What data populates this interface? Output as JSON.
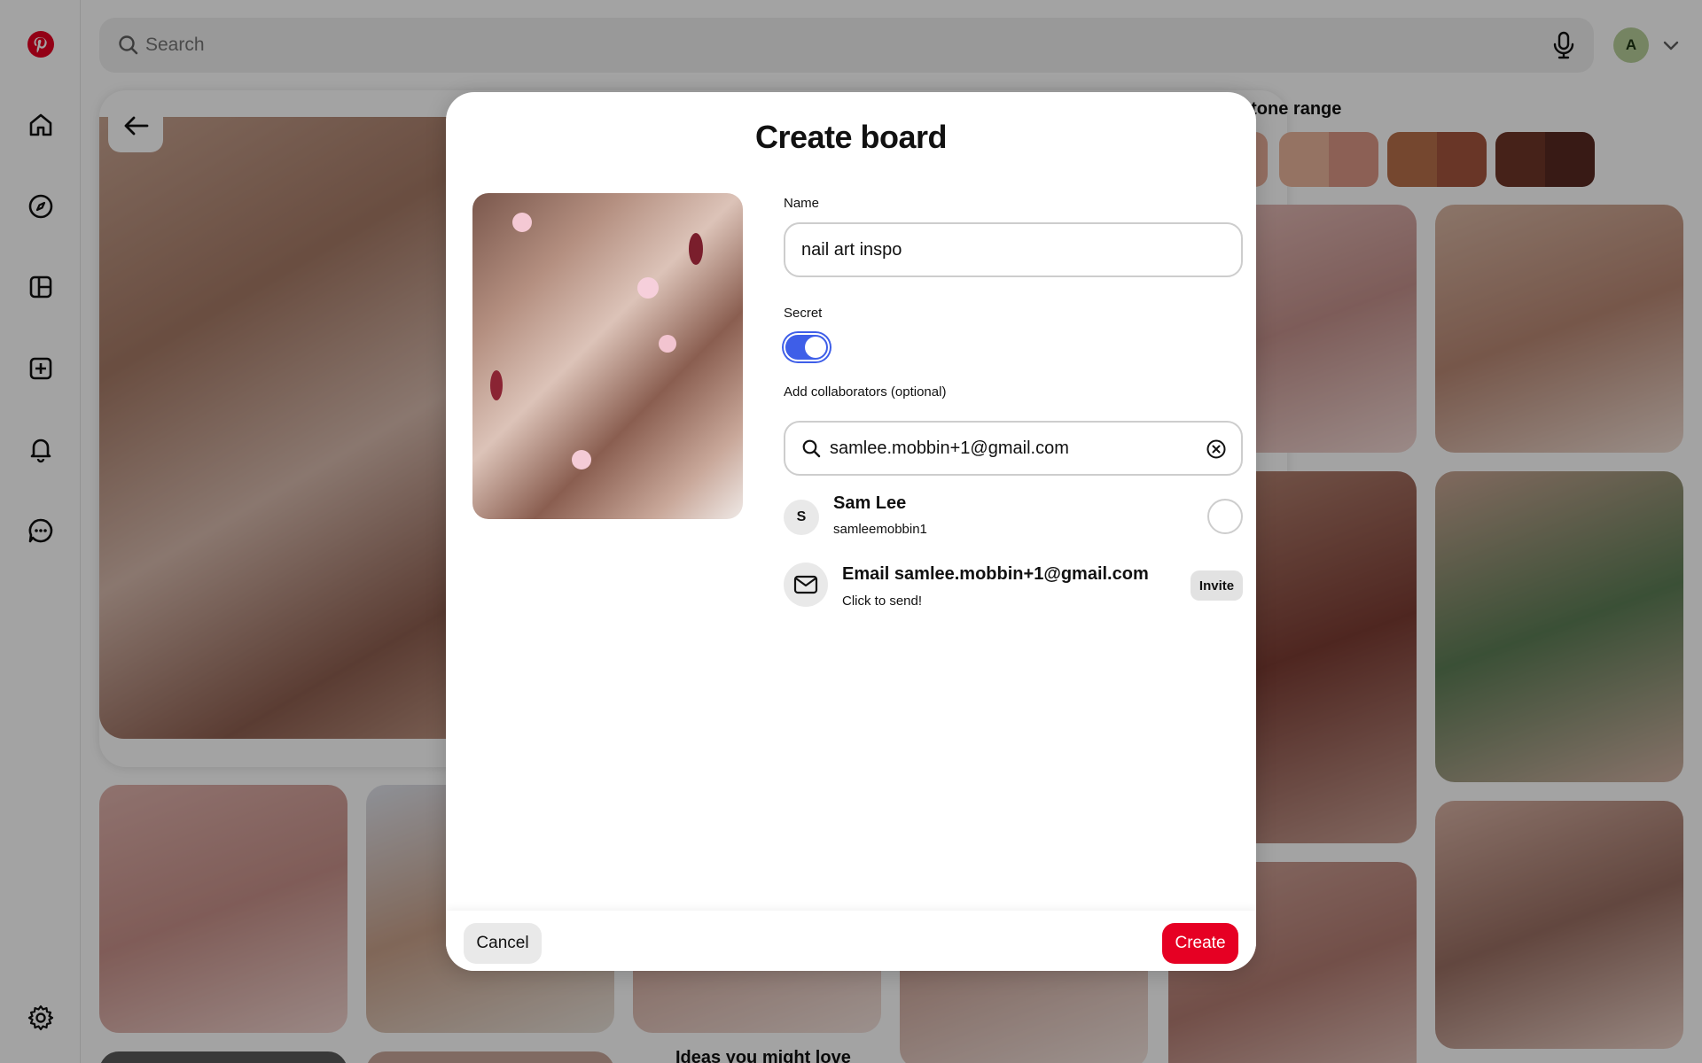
{
  "brand": {
    "logo_icon": "pinterest-logo-icon",
    "accent": "#e60023"
  },
  "sidebar": {
    "items": [
      {
        "icon": "home-icon"
      },
      {
        "icon": "explore-compass-icon"
      },
      {
        "icon": "boards-layout-icon"
      },
      {
        "icon": "create-plus-icon"
      },
      {
        "icon": "notifications-bell-icon"
      },
      {
        "icon": "messages-chat-icon"
      }
    ],
    "settings_icon": "settings-gear-icon"
  },
  "header": {
    "search_placeholder": "Search",
    "avatar_initial": "A"
  },
  "background": {
    "skin_tone_title": "ur skin tone range",
    "ideas_heading": "Ideas you might love"
  },
  "modal": {
    "title": "Create board",
    "name_label": "Name",
    "name_value": "nail art inspo",
    "secret_label": "Secret",
    "secret_enabled": true,
    "collaborators_label": "Add collaborators (optional)",
    "collaborators_query": "samlee.mobbin+1@gmail.com",
    "results": [
      {
        "initial": "S",
        "name": "Sam Lee",
        "username": "samleemobbin1"
      }
    ],
    "email_invite": {
      "title": "Email samlee.mobbin+1@gmail.com",
      "subtitle": "Click to send!",
      "button": "Invite"
    },
    "cancel_label": "Cancel",
    "create_label": "Create",
    "colors": {
      "toggle_on": "#3e5ee8",
      "create_button": "#e60023"
    }
  }
}
